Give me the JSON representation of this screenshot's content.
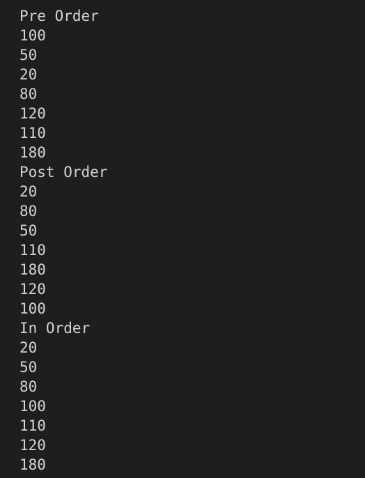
{
  "colors": {
    "background": "#1e1e1e",
    "text": "#d4d4d4"
  },
  "output": {
    "lines": [
      "Pre Order",
      "100",
      "50",
      "20",
      "80",
      "120",
      "110",
      "180",
      "Post Order",
      "20",
      "80",
      "50",
      "110",
      "180",
      "120",
      "100",
      "In Order",
      "20",
      "50",
      "80",
      "100",
      "110",
      "120",
      "180"
    ]
  }
}
